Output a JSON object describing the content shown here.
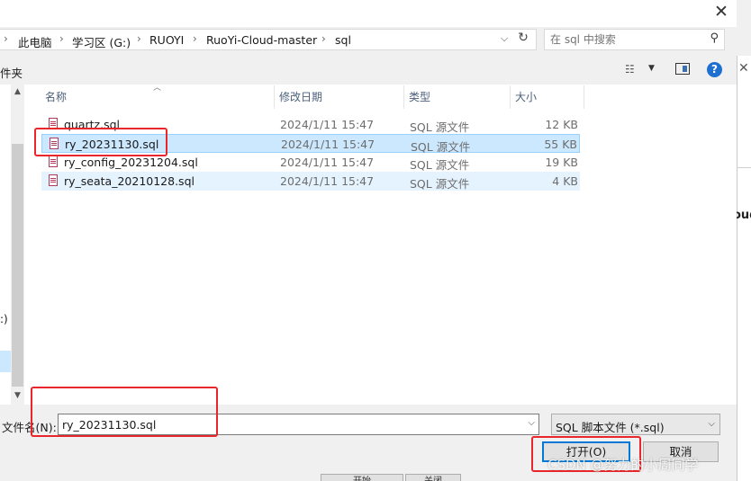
{
  "dialog": {
    "close_glyph": "✕"
  },
  "address_bar": {
    "crumbs": [
      "此电脑",
      "学习区 (G:)",
      "RUOYI",
      "RuoYi-Cloud-master",
      "sql"
    ],
    "separator": "›"
  },
  "search": {
    "placeholder": "在 sql 中搜索",
    "icon": "search-icon"
  },
  "toolbar": {
    "folder_label": "件夹",
    "help_label": "?"
  },
  "nav": {
    "drive_label": ":)"
  },
  "file_list": {
    "columns": [
      "名称",
      "修改日期",
      "类型",
      "大小"
    ],
    "rows": [
      {
        "name": "quartz.sql",
        "date": "2024/1/11 15:47",
        "type": "SQL 源文件",
        "size": "12 KB"
      },
      {
        "name": "ry_20231130.sql",
        "date": "2024/1/11 15:47",
        "type": "SQL 源文件",
        "size": "55 KB"
      },
      {
        "name": "ry_config_20231204.sql",
        "date": "2024/1/11 15:47",
        "type": "SQL 源文件",
        "size": "19 KB"
      },
      {
        "name": "ry_seata_20210128.sql",
        "date": "2024/1/11 15:47",
        "type": "SQL 源文件",
        "size": "4 KB"
      }
    ]
  },
  "bottom": {
    "filename_label": "文件名(N):",
    "filename_value": "ry_20231130.sql",
    "filetype_value": "SQL 脚本文件 (*.sql)",
    "open_label": "打开(O)",
    "cancel_label": "取消"
  },
  "background": {
    "app_text": "oud",
    "btn1_label": "开始",
    "btn2_label": "关闭"
  },
  "watermark": "CSDN @努力的小周同学",
  "colors": {
    "annotation": "#e8262b",
    "selection": "#cce8ff",
    "accent": "#0078d7"
  }
}
